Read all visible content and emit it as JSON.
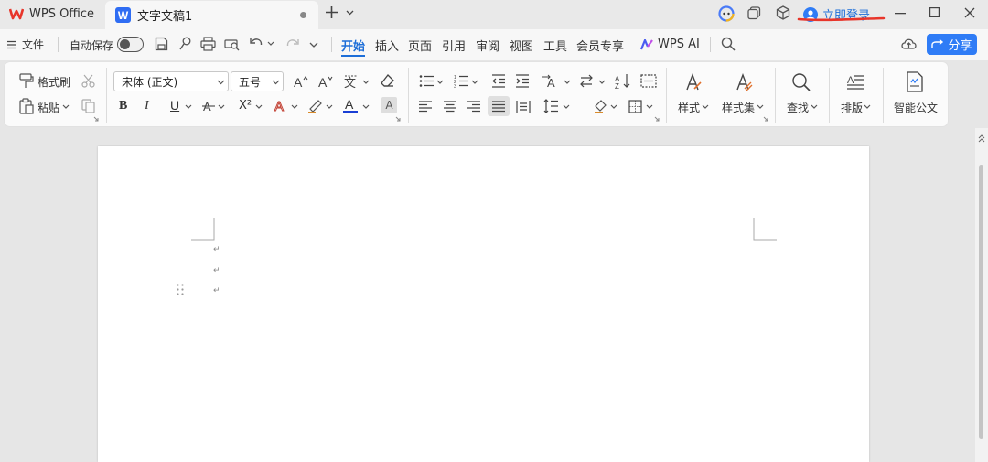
{
  "titlebar": {
    "app_name": "WPS Office",
    "doc_tab_title": "文字文稿1",
    "login_label": "立即登录"
  },
  "menubar": {
    "file_label": "文件",
    "autosave_label": "自动保存",
    "tabs": [
      "开始",
      "插入",
      "页面",
      "引用",
      "审阅",
      "视图",
      "工具",
      "会员专享",
      "WPS AI"
    ],
    "active_tab": "开始",
    "share_label": "分享"
  },
  "ribbon": {
    "format_painter": "格式刷",
    "paste": "粘贴",
    "font_name": "宋体 (正文)",
    "font_size": "五号",
    "styles": "样式",
    "style_sets": "样式集",
    "find": "查找",
    "layout": "排版",
    "official_doc": "智能公文"
  },
  "colors": {
    "accent": "#1d6ed8",
    "share_button": "#2f7cf6",
    "annotation": "#e8352a",
    "wps_logo": "#e8352a",
    "font_color_bar": "#1a3fd4"
  },
  "icons": [
    "wps-logo-icon",
    "writer-doc-icon",
    "close-tab-icon",
    "new-tab-icon",
    "ai-assistant-icon",
    "window-tile-icon",
    "cube-icon",
    "user-avatar-icon",
    "minimize-icon",
    "maximize-icon",
    "close-window-icon",
    "hamburger-icon",
    "save-icon",
    "search-icon",
    "share-cloud-icon"
  ]
}
